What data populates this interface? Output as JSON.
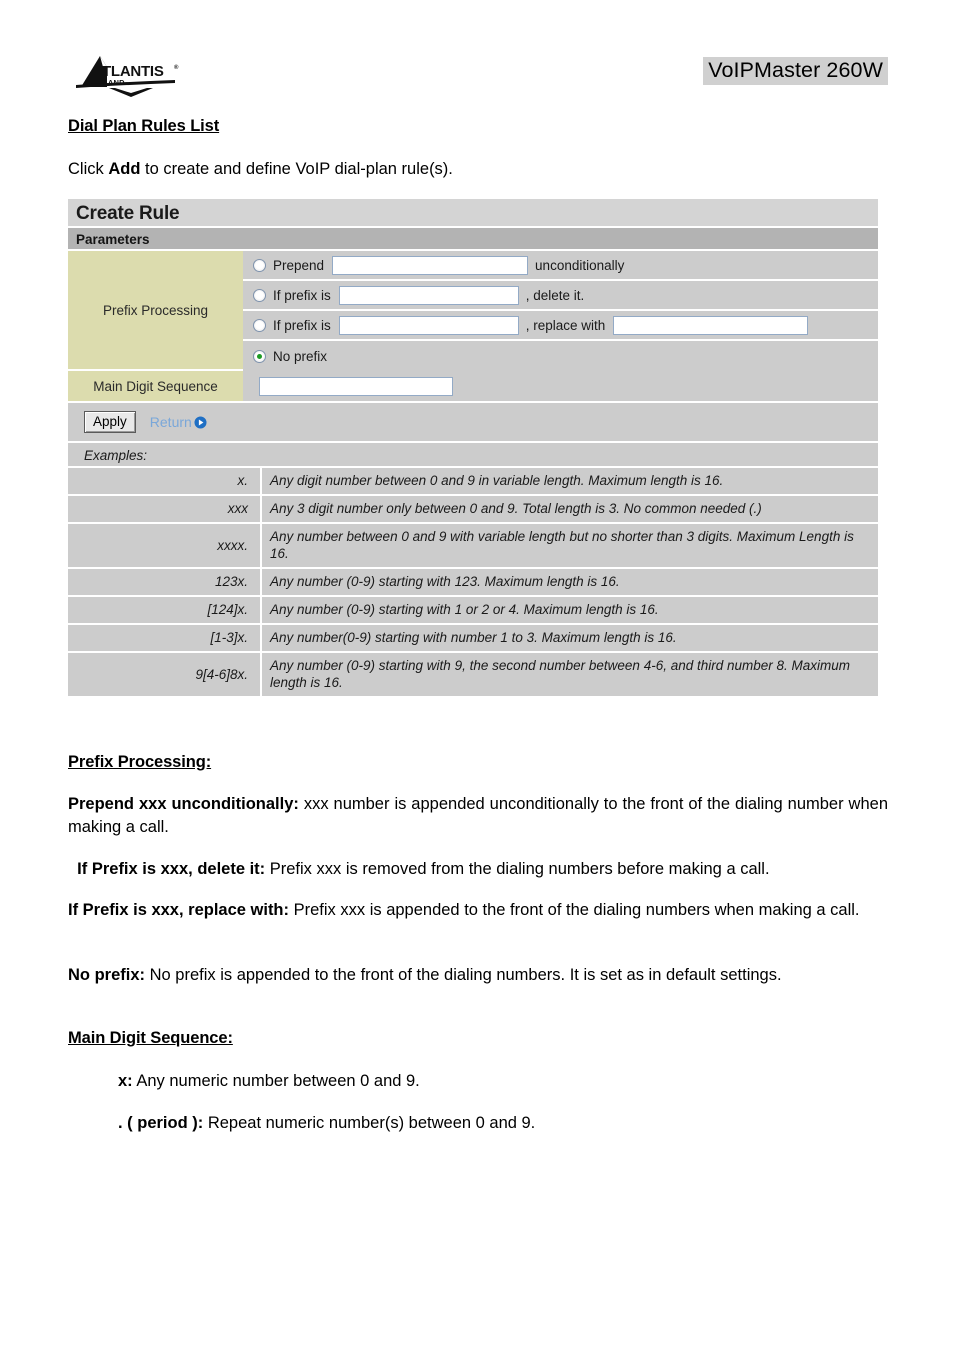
{
  "header": {
    "logo_alt": "Atlantis Land",
    "logo_word": "ATLANTIS",
    "logo_sub": "LAND",
    "product_title": "VoIPMaster 260W"
  },
  "intro": {
    "heading": "Dial Plan Rules List",
    "paragraph_prefix": "Click ",
    "paragraph_bold": "Add",
    "paragraph_suffix": " to create and define VoIP dial-plan rule(s)."
  },
  "panel": {
    "title": "Create Rule",
    "subtitle": "Parameters",
    "prefix_label": "Prefix Processing",
    "rows": [
      {
        "radio_label": "Prepend",
        "selected": false,
        "suffix": "unconditionally",
        "input_value": "",
        "input2_value": null,
        "suffix2": null
      },
      {
        "radio_label": "If prefix is",
        "selected": false,
        "suffix": ", delete it.",
        "input_value": "",
        "input2_value": null,
        "suffix2": null
      },
      {
        "radio_label": "If prefix is",
        "selected": false,
        "suffix": ", replace with",
        "input_value": "",
        "input2_value": "",
        "suffix2": null
      },
      {
        "radio_label": "No prefix",
        "selected": true,
        "suffix": null,
        "input_value": null,
        "input2_value": null,
        "suffix2": null
      }
    ],
    "digit_label": "Main Digit Sequence",
    "digit_value": "",
    "apply_label": "Apply",
    "return_label": "Return",
    "examples_caption": "Examples:",
    "examples": [
      {
        "pattern": "x.",
        "description": "Any digit number between 0 and 9 in variable length. Maximum length is 16."
      },
      {
        "pattern": "xxx",
        "description": "Any 3 digit number only between 0 and 9. Total length is 3. No common needed (.)"
      },
      {
        "pattern": "xxxx.",
        "description": "Any number between 0 and 9 with variable length but no shorter than 3 digits. Maximum Length is 16."
      },
      {
        "pattern": "123x.",
        "description": "Any number (0-9) starting with 123. Maximum length is 16."
      },
      {
        "pattern": "[124]x.",
        "description": "Any number (0-9) starting with 1 or 2 or 4. Maximum length is 16."
      },
      {
        "pattern": "[1-3]x.",
        "description": "Any number(0-9) starting with number 1 to 3. Maximum length is 16."
      },
      {
        "pattern": "9[4-6]8x.",
        "description": "Any number (0-9) starting with 9, the second number between 4-6, and third number 8. Maximum length is 16."
      }
    ]
  },
  "body": {
    "prefix_heading": "Prefix Processing:",
    "prepend_term": "Prepend xxx unconditionally:",
    "prepend_text": " xxx number is appended unconditionally to the front of the dialing number when making a call.",
    "delete_term": "If Prefix is xxx, delete it:",
    "delete_text": " Prefix xxx is removed from the dialing numbers before making a call.",
    "replace_term": "If Prefix is xxx, replace with:",
    "replace_text": "  Prefix xxx is appended to the front of the dialing numbers when making a call.",
    "noprefix_term": "No prefix:",
    "noprefix_text": " No prefix is appended to the front of the dialing numbers. It is set as in default settings.",
    "digit_heading": "Main Digit Sequence:",
    "x_term": "x:",
    "x_text": " Any numeric number between 0 and 9.",
    "period_term": ". ( period ):",
    "period_text": " Repeat numeric number(s) between 0 and 9."
  },
  "colors": {
    "label_khaki": "#dcdcae",
    "panel_gray": "#cccccc",
    "subtitle_gray": "#b3b3b3",
    "title_gray": "#d4d4d4",
    "radio_green": "#1d9b25",
    "link_blue": "#7aa7d9",
    "input_border": "#93aac6"
  }
}
